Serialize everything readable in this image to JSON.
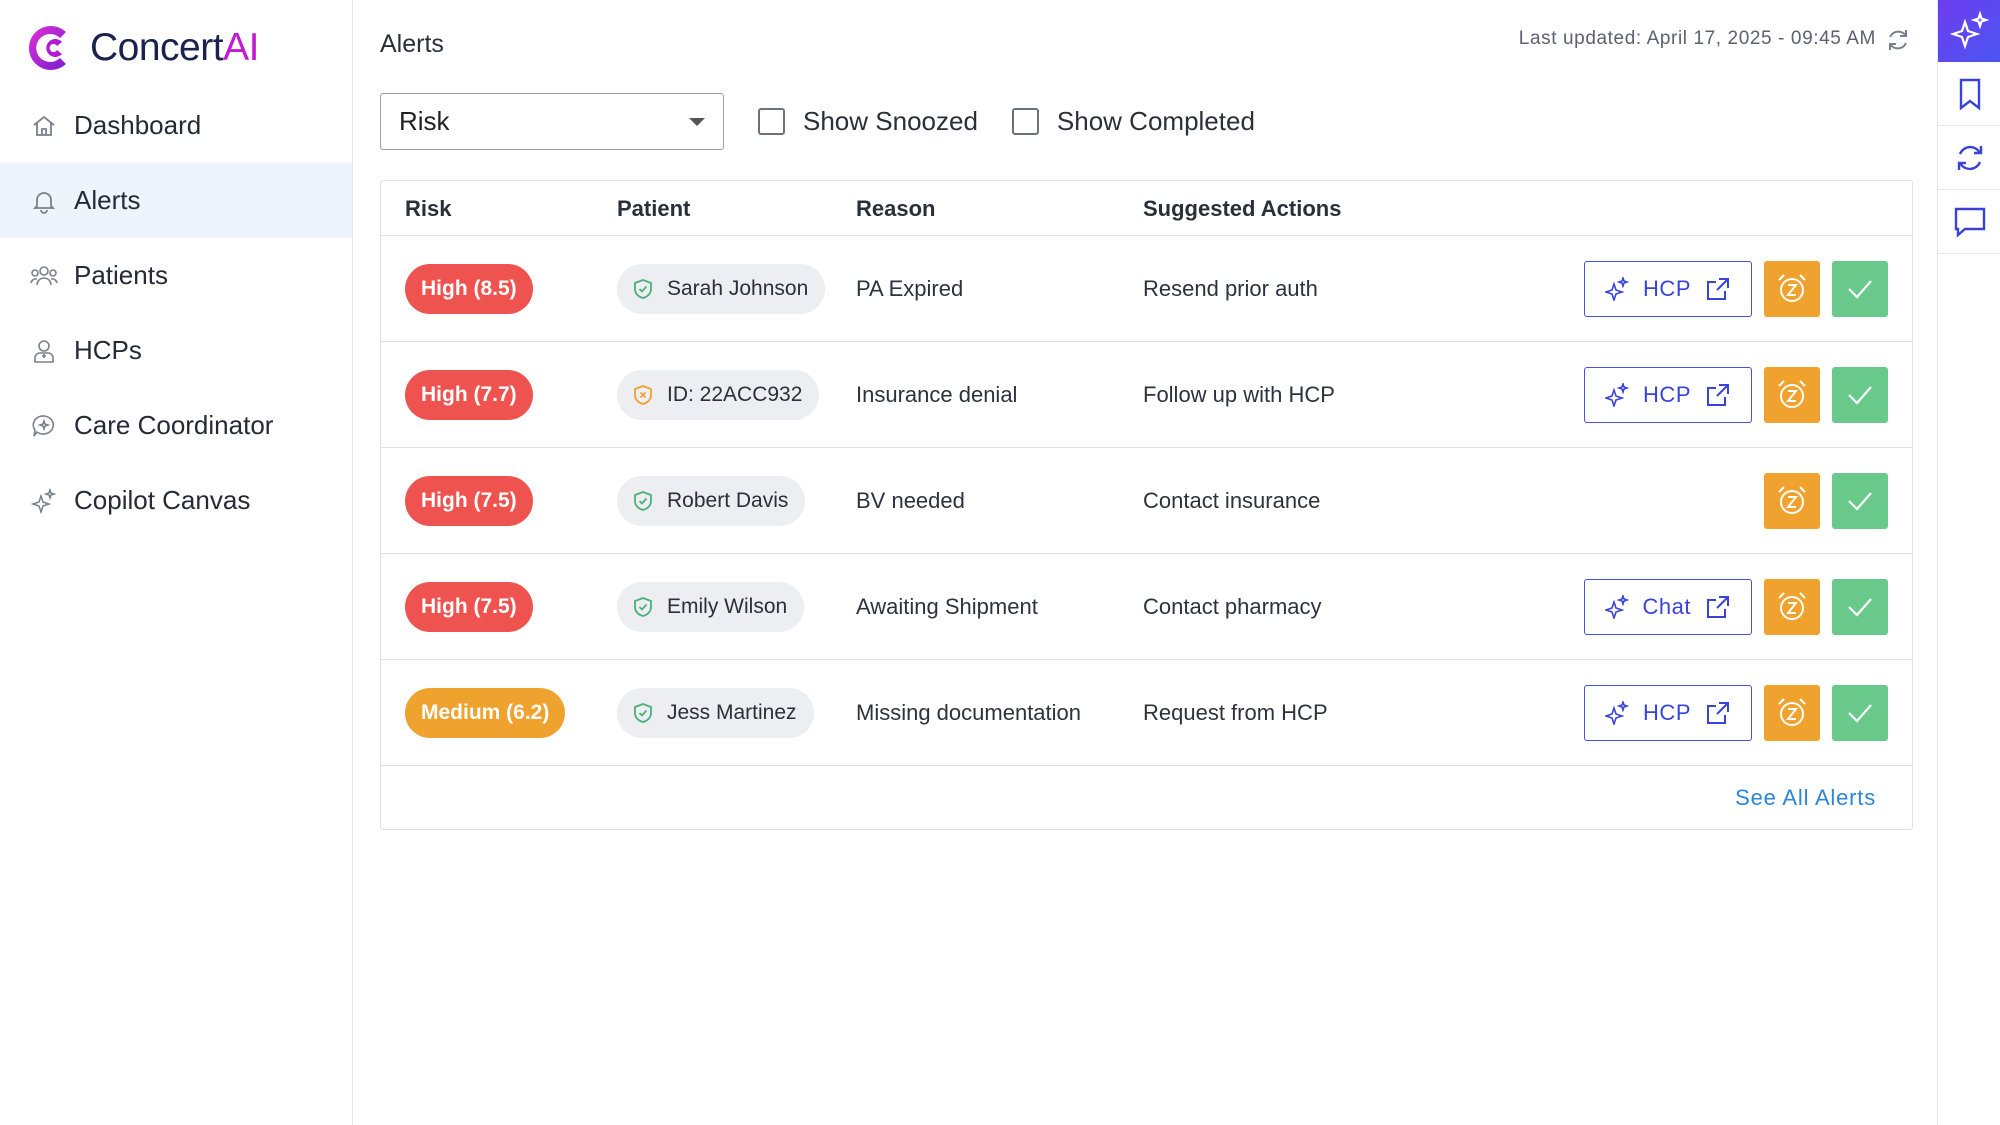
{
  "brand": {
    "name_main": "Concert",
    "name_accent": "AI",
    "colors": {
      "primary": "#c21bd1",
      "navy": "#1a2250"
    }
  },
  "sidebar": {
    "items": [
      {
        "label": "Dashboard",
        "icon": "home-icon",
        "active": false
      },
      {
        "label": "Alerts",
        "icon": "bell-icon",
        "active": true
      },
      {
        "label": "Patients",
        "icon": "people-icon",
        "active": false
      },
      {
        "label": "HCPs",
        "icon": "doctor-icon",
        "active": false
      },
      {
        "label": "Care Coordinator",
        "icon": "chat-sparkle-icon",
        "active": false
      },
      {
        "label": "Copilot Canvas",
        "icon": "sparkle-icon",
        "active": false
      }
    ]
  },
  "header": {
    "title": "Alerts",
    "last_updated": "Last updated: April 17, 2025 - 09:45 AM"
  },
  "filters": {
    "sort_select": {
      "value": "Risk"
    },
    "show_snoozed": {
      "label": "Show Snoozed",
      "checked": false
    },
    "show_completed": {
      "label": "Show Completed",
      "checked": false
    }
  },
  "table": {
    "columns": [
      "Risk",
      "Patient",
      "Reason",
      "Suggested Actions"
    ],
    "rows": [
      {
        "risk": "High (8.5)",
        "risk_level": "high",
        "patient": "Sarah Johnson",
        "shield": "green",
        "reason": "PA Expired",
        "action": "Resend prior auth",
        "copilot_label": "HCP"
      },
      {
        "risk": "High (7.7)",
        "risk_level": "high",
        "patient": "ID: 22ACC932",
        "shield": "orange",
        "reason": "Insurance denial",
        "action": "Follow up with HCP",
        "copilot_label": "HCP"
      },
      {
        "risk": "High (7.5)",
        "risk_level": "high",
        "patient": "Robert Davis",
        "shield": "green",
        "reason": "BV needed",
        "action": "Contact insurance",
        "copilot_label": ""
      },
      {
        "risk": "High (7.5)",
        "risk_level": "high",
        "patient": "Emily Wilson",
        "shield": "green",
        "reason": "Awaiting Shipment",
        "action": "Contact pharmacy",
        "copilot_label": "Chat"
      },
      {
        "risk": "Medium (6.2)",
        "risk_level": "medium",
        "patient": "Jess Martinez",
        "shield": "green",
        "reason": "Missing documentation",
        "action": "Request from HCP",
        "copilot_label": "HCP"
      }
    ],
    "see_all": "See All Alerts"
  },
  "colors": {
    "risk_high": "#ef5350",
    "risk_medium": "#f0a22e",
    "shield_green": "#4caf7a",
    "shield_orange": "#f0a22e",
    "snooze": "#f0a22e",
    "complete": "#69c98a",
    "link": "#2c86d8",
    "copilot": "#3a43d9"
  },
  "rail": {
    "icons": [
      "sparkle-icon",
      "bookmark-icon",
      "sync-icon",
      "comment-icon"
    ]
  }
}
